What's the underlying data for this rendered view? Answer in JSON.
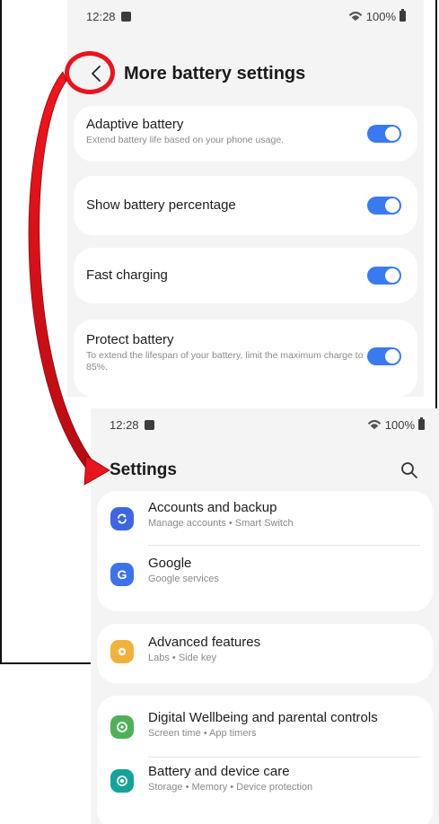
{
  "colors": {
    "toggle_on": "#3a7af0",
    "highlight_red": "#e8141e",
    "accounts_icon": "#3e66e0",
    "google_icon": "#3e72ea",
    "advanced_icon": "#f2b13a",
    "wellbeing_icon": "#4fb05a",
    "battery_icon": "#14a39a"
  },
  "battery_screen": {
    "status_time": "12:28",
    "status_battery": "100%",
    "back_icon": "chevron-left-icon",
    "title": "More battery settings",
    "settings": [
      {
        "label": "Adaptive battery",
        "description": "Extend battery life based on your phone usage.",
        "enabled": true
      },
      {
        "label": "Show battery percentage",
        "description": "",
        "enabled": true
      },
      {
        "label": "Fast charging",
        "description": "",
        "enabled": true
      },
      {
        "label": "Protect battery",
        "description": "To extend the lifespan of your battery, limit the maximum charge to 85%.",
        "enabled": true
      }
    ]
  },
  "settings_screen": {
    "status_time": "12:28",
    "status_battery": "100%",
    "title": "Settings",
    "search_icon": "search-icon",
    "items": [
      {
        "label": "Accounts and backup",
        "subtitle": "Manage accounts • Smart Switch",
        "icon": "sync-icon"
      },
      {
        "label": "Google",
        "subtitle": "Google services",
        "icon": "google-icon",
        "glyph": "G"
      },
      {
        "label": "Advanced features",
        "subtitle": "Labs • Side key",
        "icon": "gear-plus-icon"
      },
      {
        "label": "Digital Wellbeing and parental controls",
        "subtitle": "Screen time • App timers",
        "icon": "wellbeing-icon"
      },
      {
        "label": "Battery and device care",
        "subtitle": "Storage • Memory • Device protection",
        "icon": "device-care-icon"
      }
    ]
  }
}
